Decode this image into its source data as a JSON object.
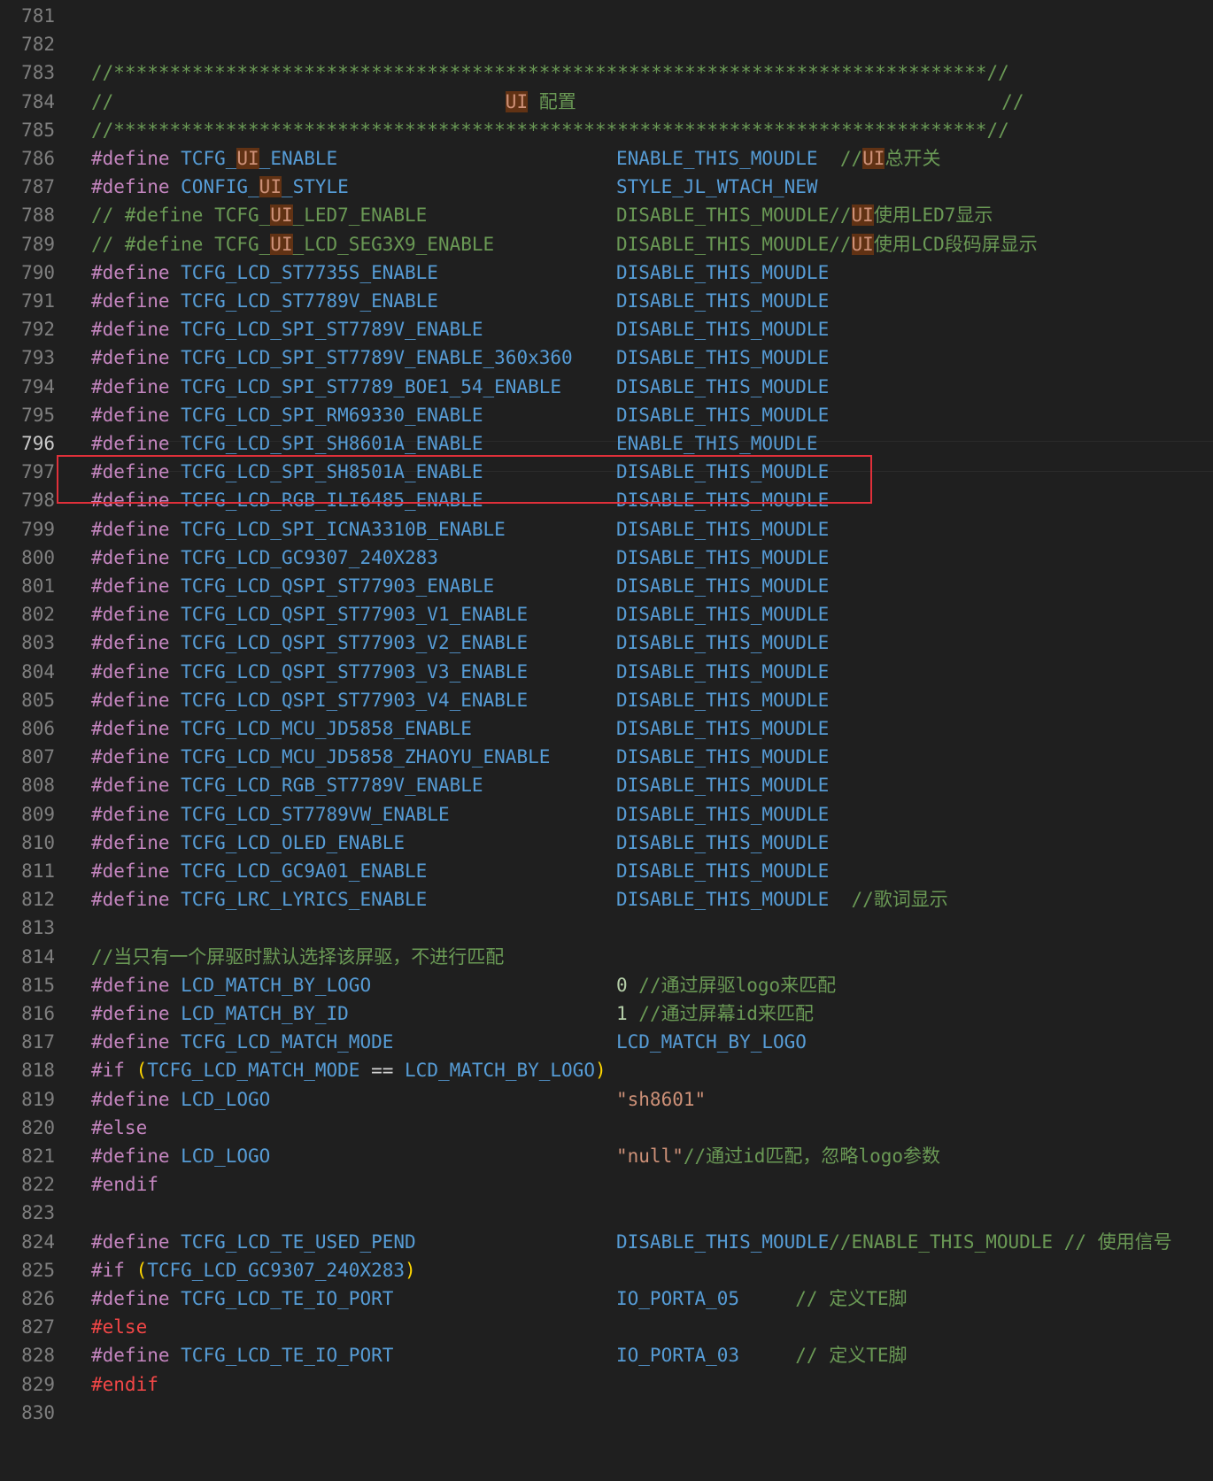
{
  "editor": {
    "current_line": "796",
    "lines": [
      {
        "n": "781",
        "t": []
      },
      {
        "n": "782",
        "t": []
      },
      {
        "n": "783",
        "t": [
          {
            "c": "cm",
            "x": "//******************************************************************************//"
          }
        ]
      },
      {
        "n": "784",
        "t": [
          {
            "c": "cm",
            "x": "//                                   "
          },
          {
            "c": "hl",
            "x": "UI"
          },
          {
            "c": "cm",
            "x": " 配置                                      //"
          }
        ]
      },
      {
        "n": "785",
        "t": [
          {
            "c": "cm",
            "x": "//******************************************************************************//"
          }
        ]
      },
      {
        "n": "786",
        "t": [
          {
            "c": "pp",
            "x": "#define "
          },
          {
            "c": "macro",
            "x": "TCFG_"
          },
          {
            "c": "hl",
            "x": "UI"
          },
          {
            "c": "macro",
            "x": "_ENABLE"
          }
        ],
        "v": [
          {
            "c": "const",
            "x": "ENABLE_THIS_MOUDLE"
          },
          {
            "c": "cm",
            "x": "  //"
          },
          {
            "c": "hl",
            "x": "UI"
          },
          {
            "c": "cm",
            "x": "总开关"
          }
        ]
      },
      {
        "n": "787",
        "t": [
          {
            "c": "pp",
            "x": "#define "
          },
          {
            "c": "macro",
            "x": "CONFIG_"
          },
          {
            "c": "hl",
            "x": "UI"
          },
          {
            "c": "macro",
            "x": "_STYLE"
          }
        ],
        "v": [
          {
            "c": "const",
            "x": "STYLE_JL_WTACH_NEW"
          }
        ]
      },
      {
        "n": "788",
        "t": [
          {
            "c": "cm",
            "x": "// #define TCFG_"
          },
          {
            "c": "hl",
            "x": "UI"
          },
          {
            "c": "cm",
            "x": "_LED7_ENABLE"
          }
        ],
        "v": [
          {
            "c": "cm",
            "x": "DISABLE_THIS_MOUDLE//"
          },
          {
            "c": "hl",
            "x": "UI"
          },
          {
            "c": "cm",
            "x": "使用LED7显示"
          }
        ]
      },
      {
        "n": "789",
        "t": [
          {
            "c": "cm",
            "x": "// #define TCFG_"
          },
          {
            "c": "hl",
            "x": "UI"
          },
          {
            "c": "cm",
            "x": "_LCD_SEG3X9_ENABLE"
          }
        ],
        "v": [
          {
            "c": "cm",
            "x": "DISABLE_THIS_MOUDLE//"
          },
          {
            "c": "hl",
            "x": "UI"
          },
          {
            "c": "cm",
            "x": "使用LCD段码屏显示"
          }
        ]
      },
      {
        "n": "790",
        "t": [
          {
            "c": "pp",
            "x": "#define "
          },
          {
            "c": "macro",
            "x": "TCFG_LCD_ST7735S_ENABLE"
          }
        ],
        "v": [
          {
            "c": "const",
            "x": "DISABLE_THIS_MOUDLE"
          }
        ]
      },
      {
        "n": "791",
        "t": [
          {
            "c": "pp",
            "x": "#define "
          },
          {
            "c": "macro",
            "x": "TCFG_LCD_ST7789V_ENABLE"
          }
        ],
        "v": [
          {
            "c": "const",
            "x": "DISABLE_THIS_MOUDLE"
          }
        ]
      },
      {
        "n": "792",
        "t": [
          {
            "c": "pp",
            "x": "#define "
          },
          {
            "c": "macro",
            "x": "TCFG_LCD_SPI_ST7789V_ENABLE"
          }
        ],
        "v": [
          {
            "c": "const",
            "x": "DISABLE_THIS_MOUDLE"
          }
        ]
      },
      {
        "n": "793",
        "t": [
          {
            "c": "pp",
            "x": "#define "
          },
          {
            "c": "macro",
            "x": "TCFG_LCD_SPI_ST7789V_ENABLE_360x360"
          }
        ],
        "v": [
          {
            "c": "const",
            "x": "DISABLE_THIS_MOUDLE"
          }
        ]
      },
      {
        "n": "794",
        "t": [
          {
            "c": "pp",
            "x": "#define "
          },
          {
            "c": "macro",
            "x": "TCFG_LCD_SPI_ST7789_BOE1_54_ENABLE"
          }
        ],
        "v": [
          {
            "c": "const",
            "x": "DISABLE_THIS_MOUDLE"
          }
        ]
      },
      {
        "n": "795",
        "t": [
          {
            "c": "pp",
            "x": "#define "
          },
          {
            "c": "macro",
            "x": "TCFG_LCD_SPI_RM69330_ENABLE"
          }
        ],
        "v": [
          {
            "c": "const",
            "x": "DISABLE_THIS_MOUDLE"
          }
        ]
      },
      {
        "n": "796",
        "t": [
          {
            "c": "pp",
            "x": "#define "
          },
          {
            "c": "macro",
            "x": "TCFG_LCD_SPI_SH8601A_ENABLE"
          }
        ],
        "v": [
          {
            "c": "const",
            "x": "ENABLE_THIS_MOUDLE"
          }
        ]
      },
      {
        "n": "797",
        "t": [
          {
            "c": "pp",
            "x": "#define "
          },
          {
            "c": "macro",
            "x": "TCFG_LCD_SPI_SH8501A_ENABLE"
          }
        ],
        "v": [
          {
            "c": "const",
            "x": "DISABLE_THIS_MOUDLE"
          }
        ]
      },
      {
        "n": "798",
        "t": [
          {
            "c": "pp",
            "x": "#define "
          },
          {
            "c": "macro",
            "x": "TCFG_LCD_RGB_ILI6485_ENABLE"
          }
        ],
        "v": [
          {
            "c": "const",
            "x": "DISABLE_THIS_MOUDLE"
          }
        ]
      },
      {
        "n": "799",
        "t": [
          {
            "c": "pp",
            "x": "#define "
          },
          {
            "c": "macro",
            "x": "TCFG_LCD_SPI_ICNA3310B_ENABLE"
          }
        ],
        "v": [
          {
            "c": "const",
            "x": "DISABLE_THIS_MOUDLE"
          }
        ]
      },
      {
        "n": "800",
        "t": [
          {
            "c": "pp",
            "x": "#define "
          },
          {
            "c": "macro",
            "x": "TCFG_LCD_GC9307_240X283"
          }
        ],
        "v": [
          {
            "c": "const",
            "x": "DISABLE_THIS_MOUDLE"
          }
        ]
      },
      {
        "n": "801",
        "t": [
          {
            "c": "pp",
            "x": "#define "
          },
          {
            "c": "macro",
            "x": "TCFG_LCD_QSPI_ST77903_ENABLE"
          }
        ],
        "v": [
          {
            "c": "const",
            "x": "DISABLE_THIS_MOUDLE"
          }
        ]
      },
      {
        "n": "802",
        "t": [
          {
            "c": "pp",
            "x": "#define "
          },
          {
            "c": "macro",
            "x": "TCFG_LCD_QSPI_ST77903_V1_ENABLE"
          }
        ],
        "v": [
          {
            "c": "const",
            "x": "DISABLE_THIS_MOUDLE"
          }
        ]
      },
      {
        "n": "803",
        "t": [
          {
            "c": "pp",
            "x": "#define "
          },
          {
            "c": "macro",
            "x": "TCFG_LCD_QSPI_ST77903_V2_ENABLE"
          }
        ],
        "v": [
          {
            "c": "const",
            "x": "DISABLE_THIS_MOUDLE"
          }
        ]
      },
      {
        "n": "804",
        "t": [
          {
            "c": "pp",
            "x": "#define "
          },
          {
            "c": "macro",
            "x": "TCFG_LCD_QSPI_ST77903_V3_ENABLE"
          }
        ],
        "v": [
          {
            "c": "const",
            "x": "DISABLE_THIS_MOUDLE"
          }
        ]
      },
      {
        "n": "805",
        "t": [
          {
            "c": "pp",
            "x": "#define "
          },
          {
            "c": "macro",
            "x": "TCFG_LCD_QSPI_ST77903_V4_ENABLE"
          }
        ],
        "v": [
          {
            "c": "const",
            "x": "DISABLE_THIS_MOUDLE"
          }
        ]
      },
      {
        "n": "806",
        "t": [
          {
            "c": "pp",
            "x": "#define "
          },
          {
            "c": "macro",
            "x": "TCFG_LCD_MCU_JD5858_ENABLE"
          }
        ],
        "v": [
          {
            "c": "const",
            "x": "DISABLE_THIS_MOUDLE"
          }
        ]
      },
      {
        "n": "807",
        "t": [
          {
            "c": "pp",
            "x": "#define "
          },
          {
            "c": "macro",
            "x": "TCFG_LCD_MCU_JD5858_ZHAOYU_ENABLE"
          }
        ],
        "v": [
          {
            "c": "const",
            "x": "DISABLE_THIS_MOUDLE"
          }
        ]
      },
      {
        "n": "808",
        "t": [
          {
            "c": "pp",
            "x": "#define "
          },
          {
            "c": "macro",
            "x": "TCFG_LCD_RGB_ST7789V_ENABLE"
          }
        ],
        "v": [
          {
            "c": "const",
            "x": "DISABLE_THIS_MOUDLE"
          }
        ]
      },
      {
        "n": "809",
        "t": [
          {
            "c": "pp",
            "x": "#define "
          },
          {
            "c": "macro",
            "x": "TCFG_LCD_ST7789VW_ENABLE"
          }
        ],
        "v": [
          {
            "c": "const",
            "x": "DISABLE_THIS_MOUDLE"
          }
        ]
      },
      {
        "n": "810",
        "t": [
          {
            "c": "pp",
            "x": "#define "
          },
          {
            "c": "macro",
            "x": "TCFG_LCD_OLED_ENABLE"
          }
        ],
        "v": [
          {
            "c": "const",
            "x": "DISABLE_THIS_MOUDLE"
          }
        ]
      },
      {
        "n": "811",
        "t": [
          {
            "c": "pp",
            "x": "#define "
          },
          {
            "c": "macro",
            "x": "TCFG_LCD_GC9A01_ENABLE"
          }
        ],
        "v": [
          {
            "c": "const",
            "x": "DISABLE_THIS_MOUDLE"
          }
        ]
      },
      {
        "n": "812",
        "t": [
          {
            "c": "pp",
            "x": "#define "
          },
          {
            "c": "macro",
            "x": "TCFG_LRC_LYRICS_ENABLE"
          }
        ],
        "v": [
          {
            "c": "const",
            "x": "DISABLE_THIS_MOUDLE"
          },
          {
            "c": "cm",
            "x": "  //歌词显示"
          }
        ]
      },
      {
        "n": "813",
        "t": []
      },
      {
        "n": "814",
        "t": [
          {
            "c": "cm",
            "x": "//当只有一个屏驱时默认选择该屏驱，不进行匹配"
          }
        ]
      },
      {
        "n": "815",
        "t": [
          {
            "c": "pp",
            "x": "#define "
          },
          {
            "c": "macro",
            "x": "LCD_MATCH_BY_LOGO"
          }
        ],
        "v": [
          {
            "c": "num",
            "x": "0"
          },
          {
            "c": "cm",
            "x": " //通过屏驱logo来匹配"
          }
        ]
      },
      {
        "n": "816",
        "t": [
          {
            "c": "pp",
            "x": "#define "
          },
          {
            "c": "macro",
            "x": "LCD_MATCH_BY_ID"
          }
        ],
        "v": [
          {
            "c": "num",
            "x": "1"
          },
          {
            "c": "cm",
            "x": " //通过屏幕id来匹配"
          }
        ]
      },
      {
        "n": "817",
        "t": [
          {
            "c": "pp",
            "x": "#define "
          },
          {
            "c": "macro",
            "x": "TCFG_LCD_MATCH_MODE"
          }
        ],
        "v": [
          {
            "c": "const",
            "x": "LCD_MATCH_BY_LOGO"
          }
        ]
      },
      {
        "n": "818",
        "t": [
          {
            "c": "pp",
            "x": "#if "
          },
          {
            "c": "paren",
            "x": "("
          },
          {
            "c": "const",
            "x": "TCFG_LCD_MATCH_MODE"
          },
          {
            "c": "op",
            "x": " == "
          },
          {
            "c": "const",
            "x": "LCD_MATCH_BY_LOGO"
          },
          {
            "c": "paren",
            "x": ")"
          }
        ]
      },
      {
        "n": "819",
        "t": [
          {
            "c": "pp",
            "x": "#define "
          },
          {
            "c": "macro",
            "x": "LCD_LOGO"
          }
        ],
        "v": [
          {
            "c": "str",
            "x": "\"sh8601\""
          }
        ]
      },
      {
        "n": "820",
        "t": [
          {
            "c": "pp",
            "x": "#else"
          }
        ]
      },
      {
        "n": "821",
        "t": [
          {
            "c": "pp",
            "x": "#define "
          },
          {
            "c": "macro",
            "x": "LCD_LOGO"
          }
        ],
        "v": [
          {
            "c": "str",
            "x": "\"null\""
          },
          {
            "c": "cm",
            "x": "//通过id匹配，忽略logo参数"
          }
        ]
      },
      {
        "n": "822",
        "t": [
          {
            "c": "pp",
            "x": "#endif"
          }
        ]
      },
      {
        "n": "823",
        "t": []
      },
      {
        "n": "824",
        "t": [
          {
            "c": "pp",
            "x": "#define "
          },
          {
            "c": "macro",
            "x": "TCFG_LCD_TE_USED_PEND"
          }
        ],
        "v": [
          {
            "c": "const",
            "x": "DISABLE_THIS_MOUDLE"
          },
          {
            "c": "cm",
            "x": "//ENABLE_THIS_MOUDLE // 使用信号"
          }
        ]
      },
      {
        "n": "825",
        "t": [
          {
            "c": "pp",
            "x": "#if "
          },
          {
            "c": "paren",
            "x": "("
          },
          {
            "c": "const",
            "x": "TCFG_LCD_GC9307_240X283"
          },
          {
            "c": "paren",
            "x": ")"
          }
        ]
      },
      {
        "n": "826",
        "t": [
          {
            "c": "pp",
            "x": "#define "
          },
          {
            "c": "macro",
            "x": "TCFG_LCD_TE_IO_PORT"
          }
        ],
        "v": [
          {
            "c": "const",
            "x": "IO_PORTA_05"
          },
          {
            "c": "cm",
            "x": "     // 定义TE脚"
          }
        ]
      },
      {
        "n": "827",
        "t": [
          {
            "c": "ppred",
            "x": "#else"
          }
        ]
      },
      {
        "n": "828",
        "t": [
          {
            "c": "pp",
            "x": "#define "
          },
          {
            "c": "macro",
            "x": "TCFG_LCD_TE_IO_PORT"
          }
        ],
        "v": [
          {
            "c": "const",
            "x": "IO_PORTA_03"
          },
          {
            "c": "cm",
            "x": "     // 定义TE脚"
          }
        ]
      },
      {
        "n": "829",
        "t": [
          {
            "c": "ppred",
            "x": "#endif"
          }
        ]
      },
      {
        "n": "830",
        "t": []
      }
    ]
  }
}
